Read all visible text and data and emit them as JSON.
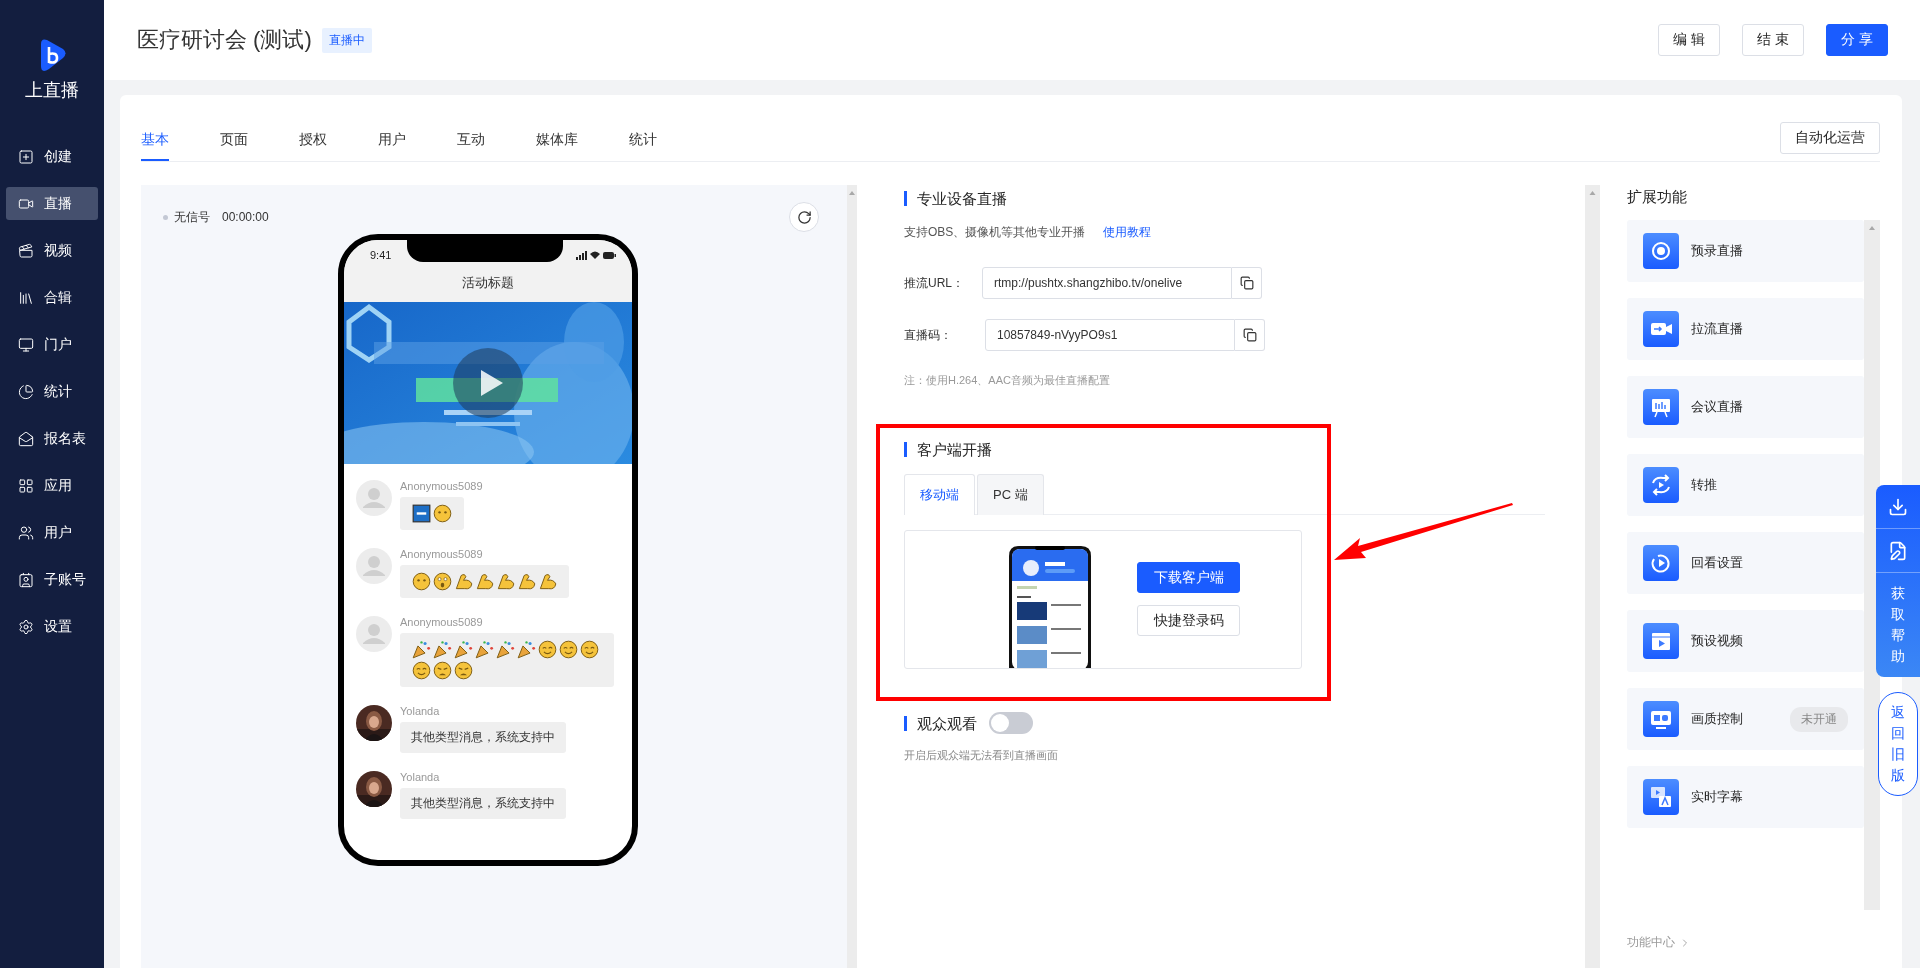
{
  "sidebar": {
    "brand": "上直播",
    "items": [
      {
        "label": "创建",
        "kind": "create",
        "selected": false
      },
      {
        "label": "直播",
        "kind": "live",
        "selected": true
      },
      {
        "label": "视频",
        "kind": "video",
        "selected": false
      },
      {
        "label": "合辑",
        "kind": "collection",
        "selected": false
      },
      {
        "label": "门户",
        "kind": "portal",
        "selected": false
      },
      {
        "label": "统计",
        "kind": "stats",
        "selected": false
      },
      {
        "label": "报名表",
        "kind": "form",
        "selected": false
      },
      {
        "label": "应用",
        "kind": "apps",
        "selected": false
      },
      {
        "label": "用户",
        "kind": "users",
        "selected": false
      },
      {
        "label": "子账号",
        "kind": "subaccounts",
        "selected": false
      },
      {
        "label": "设置",
        "kind": "settings",
        "selected": false
      }
    ]
  },
  "header": {
    "title": "医疗研讨会 (测试)",
    "status": "直播中",
    "buttons": [
      {
        "label": "编 辑",
        "kind": "default"
      },
      {
        "label": "结 束",
        "kind": "default"
      },
      {
        "label": "分 享",
        "kind": "primary"
      }
    ]
  },
  "tabs": [
    {
      "label": "基本",
      "selected": true
    },
    {
      "label": "页面",
      "selected": false
    },
    {
      "label": "授权",
      "selected": false
    },
    {
      "label": "用户",
      "selected": false
    },
    {
      "label": "互动",
      "selected": false
    },
    {
      "label": "媒体库",
      "selected": false
    },
    {
      "label": "统计",
      "selected": false
    }
  ],
  "automation_button": "自动化运营",
  "preview": {
    "signal": "无信号",
    "time": "00:00:00",
    "phone": {
      "clock": "9:41",
      "title": "活动标题",
      "messages": [
        {
          "name": "Anonymous5089",
          "avatar": {
            "kind": "placeholder"
          },
          "emojis": [
            {
              "kind": "sticker"
            },
            {
              "kind": "neutral"
            }
          ]
        },
        {
          "name": "Anonymous5089",
          "avatar": {
            "kind": "placeholder"
          },
          "emojis": [
            {
              "kind": "neutral"
            },
            {
              "kind": "surprised"
            },
            {
              "kind": "muscle"
            },
            {
              "kind": "muscle"
            },
            {
              "kind": "muscle"
            },
            {
              "kind": "muscle"
            },
            {
              "kind": "muscle"
            }
          ]
        },
        {
          "name": "Anonymous5089",
          "avatar": {
            "kind": "placeholder"
          },
          "emojis": [
            {
              "kind": "party"
            },
            {
              "kind": "party"
            },
            {
              "kind": "party"
            },
            {
              "kind": "party"
            },
            {
              "kind": "party"
            },
            {
              "kind": "party"
            },
            {
              "kind": "smile"
            },
            {
              "kind": "smile"
            },
            {
              "kind": "smile"
            },
            {
              "kind": "smile"
            },
            {
              "kind": "weary"
            },
            {
              "kind": "weary"
            }
          ]
        },
        {
          "name": "Yolanda",
          "text": "其他类型消息，系统支持中"
        },
        {
          "name": "Yolanda",
          "text": "其他类型消息，系统支持中"
        }
      ]
    }
  },
  "pro_stream": {
    "title": "专业设备直播",
    "description": "支持OBS、摄像机等其他专业开播",
    "link": "使用教程",
    "fields": [
      {
        "label": "推流URL：",
        "value": "rtmp://pushtx.shangzhibo.tv/onelive"
      },
      {
        "label": "直播码：",
        "value": "10857849-nVyyPO9s1"
      }
    ],
    "note": "注：使用H.264、AAC音频为最佳直播配置"
  },
  "client_stream": {
    "title": "客户端开播",
    "tabs": [
      {
        "label": "移动端",
        "selected": true
      },
      {
        "label": "PC 端",
        "selected": false
      }
    ],
    "buttons": [
      {
        "label": "下载客户端",
        "kind": "primary"
      },
      {
        "label": "快捷登录码",
        "kind": "default"
      }
    ]
  },
  "audience": {
    "title": "观众观看",
    "on": false,
    "hint": "开启后观众端无法看到直播画面"
  },
  "extensions": {
    "title": "扩展功能",
    "items": [
      {
        "label": "预录直播",
        "kind": "record"
      },
      {
        "label": "拉流直播",
        "kind": "pull"
      },
      {
        "label": "会议直播",
        "kind": "meeting"
      },
      {
        "label": "转推",
        "kind": "relay"
      },
      {
        "label": "回看设置",
        "kind": "replay"
      },
      {
        "label": "预设视频",
        "kind": "preset"
      },
      {
        "label": "画质控制",
        "kind": "hd",
        "badge": "未开通"
      },
      {
        "label": "实时字幕",
        "kind": "subtitle"
      }
    ],
    "footer": "功能中心"
  },
  "help": {
    "label": "获取帮助",
    "old_version": "返回旧版"
  }
}
